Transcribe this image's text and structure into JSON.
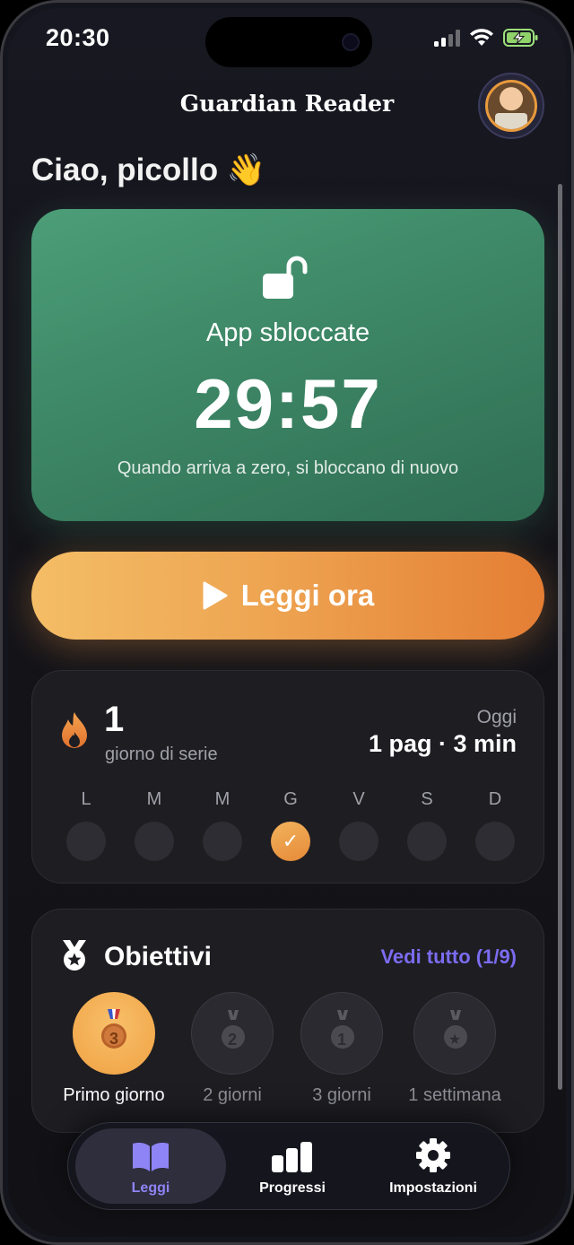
{
  "status": {
    "time": "20:30",
    "signal_icon": "cellular-signal-icon",
    "wifi_icon": "wifi-icon",
    "battery_icon": "battery-charging-icon"
  },
  "header": {
    "title": "Guardian Reader",
    "avatar_icon": "profile-avatar"
  },
  "greeting": "Ciao, picollo 👋",
  "unlock": {
    "icon": "unlocked-padlock-icon",
    "label": "App sbloccate",
    "timer": "29:57",
    "hint": "Quando arriva a zero, si bloccano di nuovo",
    "color": "#3d8766"
  },
  "read_button": {
    "icon": "play-icon",
    "label": "Leggi ora",
    "color_start": "#f4bd66",
    "color_end": "#e47e34"
  },
  "streak": {
    "icon": "flame-icon",
    "count": "1",
    "label": "giorno di serie",
    "today_label": "Oggi",
    "today_value": "1 pag · 3 min",
    "days": [
      {
        "letter": "L",
        "done": false,
        "mark": ""
      },
      {
        "letter": "M",
        "done": false,
        "mark": ""
      },
      {
        "letter": "M",
        "done": false,
        "mark": ""
      },
      {
        "letter": "G",
        "done": true,
        "mark": "✓"
      },
      {
        "letter": "V",
        "done": false,
        "mark": ""
      },
      {
        "letter": "S",
        "done": false,
        "mark": ""
      },
      {
        "letter": "D",
        "done": false,
        "mark": ""
      }
    ]
  },
  "goals": {
    "icon": "medal-icon",
    "title": "Obiettivi",
    "link": "Vedi tutto (1/9)",
    "link_color": "#7b6cf0",
    "badges": [
      {
        "label": "Primo giorno",
        "number": "3",
        "unlocked": true
      },
      {
        "label": "2 giorni",
        "number": "2",
        "unlocked": false
      },
      {
        "label": "3 giorni",
        "number": "1",
        "unlocked": false
      },
      {
        "label": "1 settimana",
        "number": "★",
        "unlocked": false
      }
    ]
  },
  "tabs": [
    {
      "label": "Leggi",
      "icon": "book-icon",
      "active": true
    },
    {
      "label": "Progressi",
      "icon": "bar-chart-icon",
      "active": false
    },
    {
      "label": "Impostazioni",
      "icon": "gear-icon",
      "active": false
    }
  ]
}
